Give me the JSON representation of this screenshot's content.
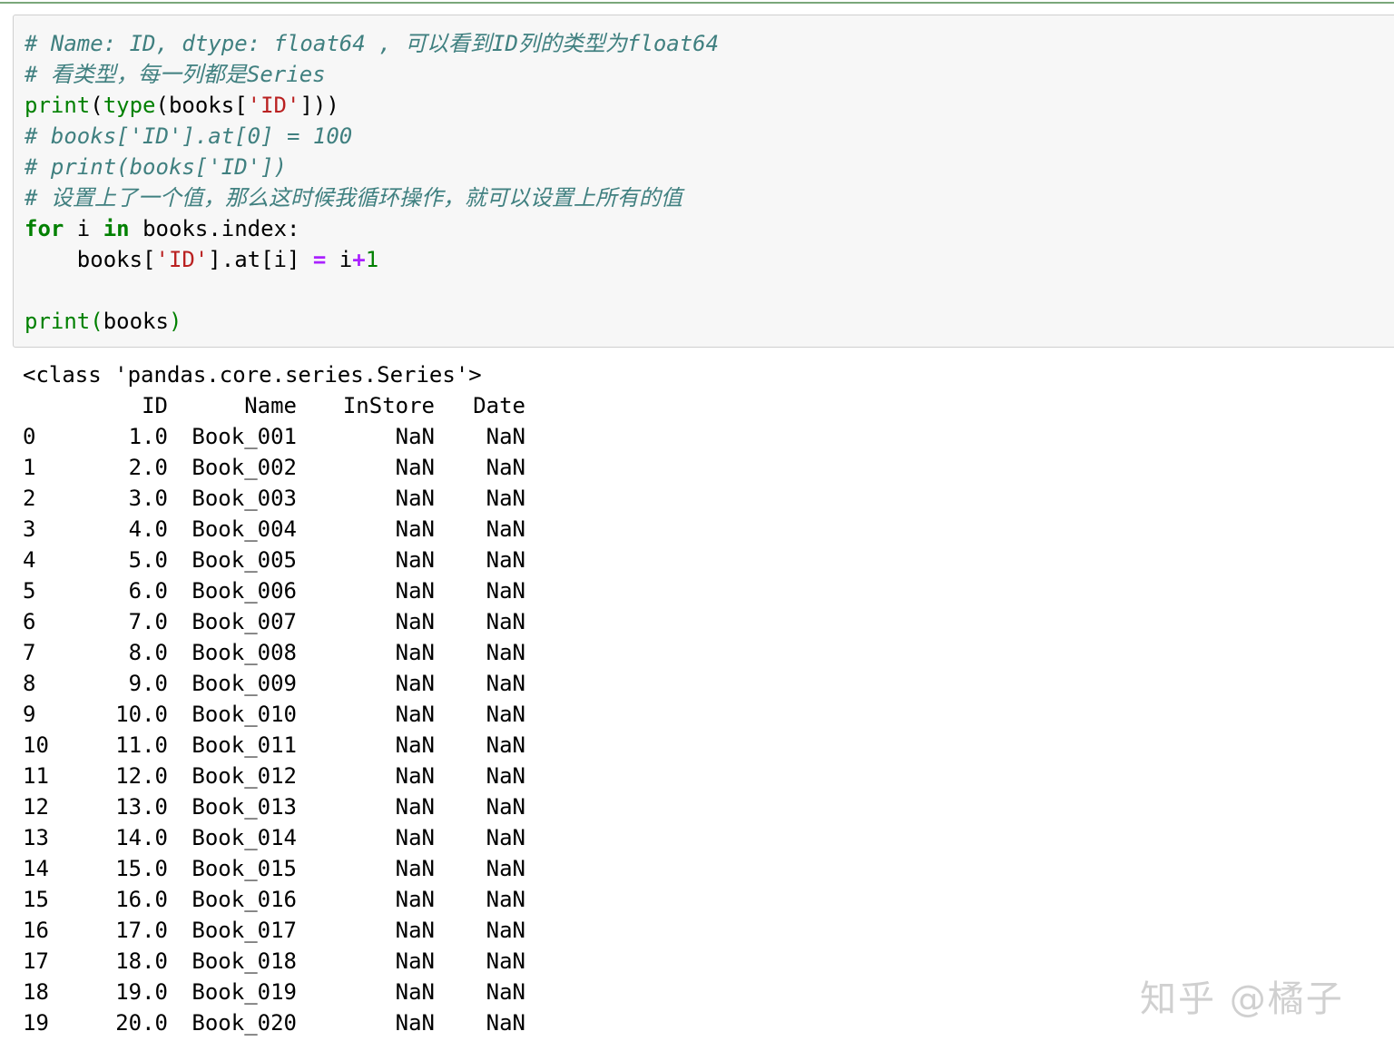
{
  "code": {
    "line1": "# Name: ID, dtype: float64 , 可以看到ID列的类型为float64",
    "line2": "# 看类型，每一列都是Series",
    "line3": {
      "fn": "print",
      "p1": "(",
      "fn2": "type",
      "p2": "(books[",
      "str": "'ID'",
      "p3": "]))"
    },
    "line4": "# books['ID'].at[0] = 100",
    "line5": "# print(books['ID'])",
    "line6": "# 设置上了一个值，那么这时候我循环操作，就可以设置上所有的值",
    "line7": {
      "kw1": "for",
      "t1": " i ",
      "kw2": "in",
      "t2": " books.index:"
    },
    "line8": {
      "indent": "    books[",
      "str": "'ID'",
      "t1": "].at[i] ",
      "op1": "=",
      "t2": " i",
      "op2": "+",
      "num": "1"
    },
    "line10": {
      "fn": "print",
      "p1": "(",
      "t1": "books",
      "p2": ")"
    }
  },
  "output": {
    "class_line": "<class 'pandas.core.series.Series'>",
    "headers": {
      "id": "ID",
      "name": "Name",
      "instore": "InStore",
      "date": "Date"
    },
    "rows": [
      {
        "idx": "0",
        "id": "1.0",
        "name": "Book_001",
        "instore": "NaN",
        "date": "NaN"
      },
      {
        "idx": "1",
        "id": "2.0",
        "name": "Book_002",
        "instore": "NaN",
        "date": "NaN"
      },
      {
        "idx": "2",
        "id": "3.0",
        "name": "Book_003",
        "instore": "NaN",
        "date": "NaN"
      },
      {
        "idx": "3",
        "id": "4.0",
        "name": "Book_004",
        "instore": "NaN",
        "date": "NaN"
      },
      {
        "idx": "4",
        "id": "5.0",
        "name": "Book_005",
        "instore": "NaN",
        "date": "NaN"
      },
      {
        "idx": "5",
        "id": "6.0",
        "name": "Book_006",
        "instore": "NaN",
        "date": "NaN"
      },
      {
        "idx": "6",
        "id": "7.0",
        "name": "Book_007",
        "instore": "NaN",
        "date": "NaN"
      },
      {
        "idx": "7",
        "id": "8.0",
        "name": "Book_008",
        "instore": "NaN",
        "date": "NaN"
      },
      {
        "idx": "8",
        "id": "9.0",
        "name": "Book_009",
        "instore": "NaN",
        "date": "NaN"
      },
      {
        "idx": "9",
        "id": "10.0",
        "name": "Book_010",
        "instore": "NaN",
        "date": "NaN"
      },
      {
        "idx": "10",
        "id": "11.0",
        "name": "Book_011",
        "instore": "NaN",
        "date": "NaN"
      },
      {
        "idx": "11",
        "id": "12.0",
        "name": "Book_012",
        "instore": "NaN",
        "date": "NaN"
      },
      {
        "idx": "12",
        "id": "13.0",
        "name": "Book_013",
        "instore": "NaN",
        "date": "NaN"
      },
      {
        "idx": "13",
        "id": "14.0",
        "name": "Book_014",
        "instore": "NaN",
        "date": "NaN"
      },
      {
        "idx": "14",
        "id": "15.0",
        "name": "Book_015",
        "instore": "NaN",
        "date": "NaN"
      },
      {
        "idx": "15",
        "id": "16.0",
        "name": "Book_016",
        "instore": "NaN",
        "date": "NaN"
      },
      {
        "idx": "16",
        "id": "17.0",
        "name": "Book_017",
        "instore": "NaN",
        "date": "NaN"
      },
      {
        "idx": "17",
        "id": "18.0",
        "name": "Book_018",
        "instore": "NaN",
        "date": "NaN"
      },
      {
        "idx": "18",
        "id": "19.0",
        "name": "Book_019",
        "instore": "NaN",
        "date": "NaN"
      },
      {
        "idx": "19",
        "id": "20.0",
        "name": "Book_020",
        "instore": "NaN",
        "date": "NaN"
      }
    ]
  },
  "watermark": "知乎 @橘子",
  "colors": {
    "comment": "#408080",
    "keyword": "#008000",
    "string": "#ba2121",
    "operator": "#aa22ff",
    "cell_background": "#f7f7f7",
    "cell_border": "#cfcfcf"
  }
}
